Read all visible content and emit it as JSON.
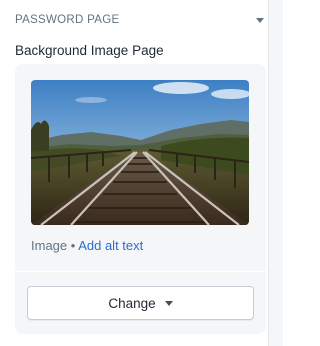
{
  "section": {
    "title": "PASSWORD PAGE",
    "toggle_icon": "caret-down-icon"
  },
  "field": {
    "label": "Background Image Page"
  },
  "image": {
    "subject": "railway tracks on a bridge",
    "meta_prefix": "Image • ",
    "alt_link": "Add alt text"
  },
  "actions": {
    "change_label": "Change",
    "change_icon": "caret-down-icon"
  },
  "colors": {
    "link": "#2c6ecb",
    "card_bg": "#f4f6f8",
    "muted_text": "#637381"
  }
}
